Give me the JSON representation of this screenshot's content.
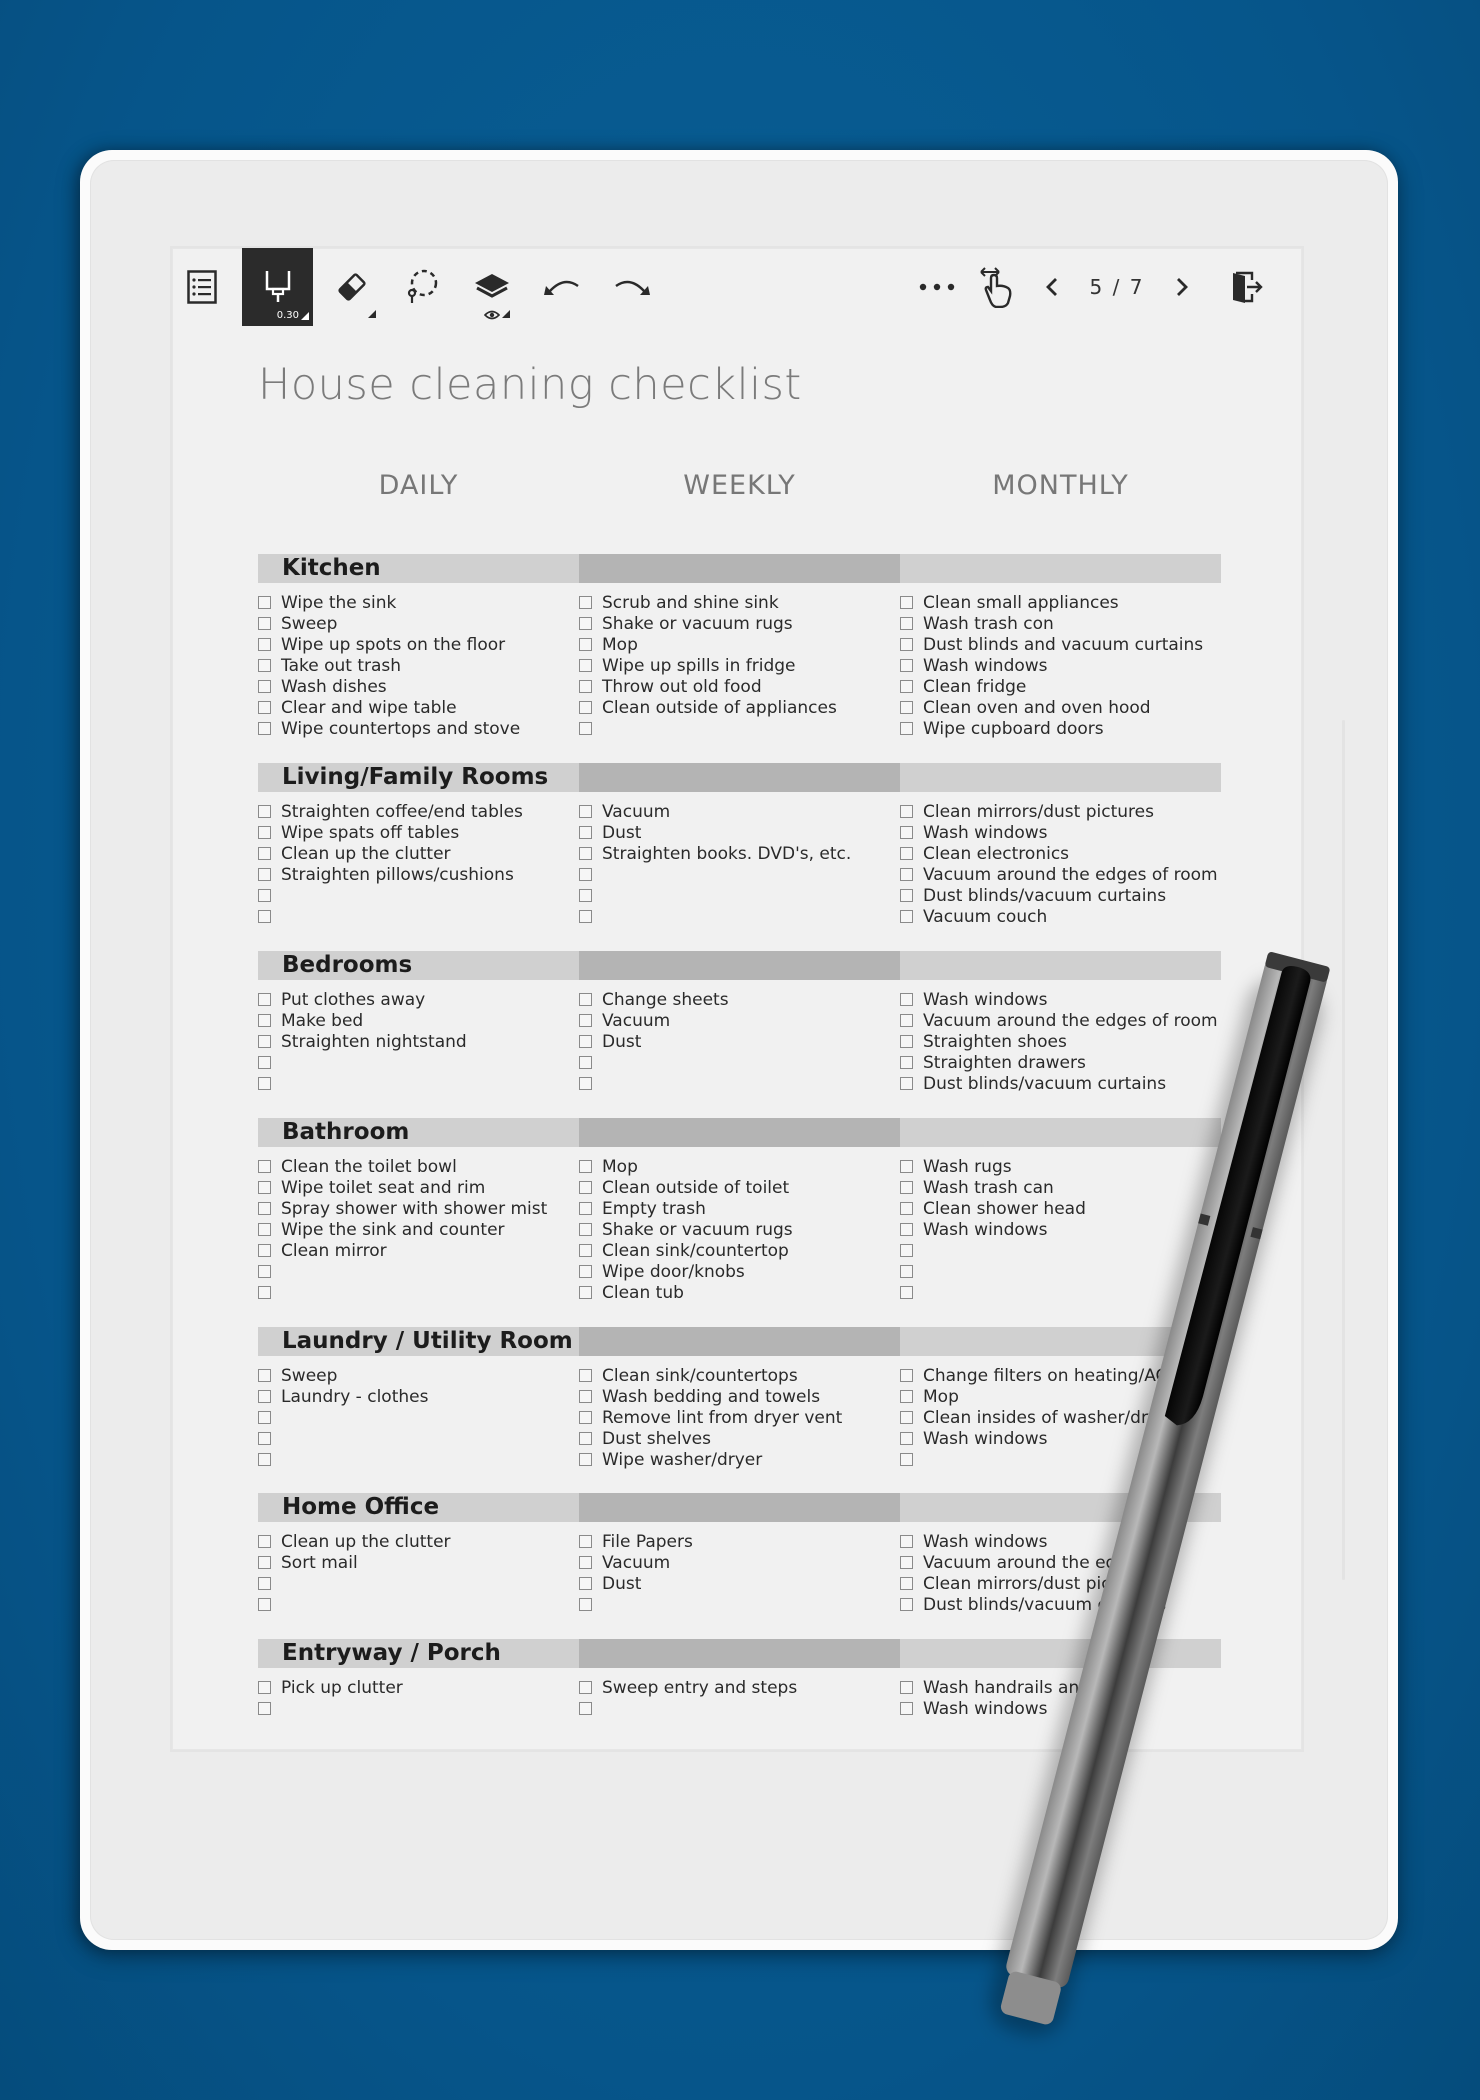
{
  "toolbar": {
    "items": [
      {
        "name": "document-list",
        "icon": "list-icon"
      },
      {
        "name": "pen-tool",
        "icon": "fineliner-pen-icon",
        "active": true,
        "size": "0.30"
      },
      {
        "name": "eraser-tool",
        "icon": "eraser-icon"
      },
      {
        "name": "selection-tool",
        "icon": "lasso-select-icon"
      },
      {
        "name": "layers",
        "icon": "layers-icon",
        "sub_icon": "eye-icon"
      },
      {
        "name": "undo",
        "icon": "undo-icon"
      },
      {
        "name": "redo",
        "icon": "redo-icon"
      }
    ],
    "right": [
      {
        "name": "more",
        "icon": "more-dots-icon"
      },
      {
        "name": "touch",
        "icon": "touch-swipe-icon"
      },
      {
        "name": "prev-page",
        "icon": "chevron-left-icon"
      },
      {
        "name": "next-page",
        "icon": "chevron-right-icon"
      },
      {
        "name": "exit",
        "icon": "exit-door-icon"
      }
    ],
    "pen_size": "0.30",
    "page_indicator": "5 / 7"
  },
  "document": {
    "title": "House cleaning checklist",
    "columns": [
      "DAILY",
      "WEEKLY",
      "MONTHLY"
    ],
    "sections": [
      {
        "name": "Kitchen",
        "daily": [
          "Wipe the sink",
          "Sweep",
          "Wipe up spots on the floor",
          "Take out trash",
          "Wash dishes",
          "Clear and wipe table",
          "Wipe countertops and stove"
        ],
        "weekly": [
          "Scrub and shine sink",
          "Shake or vacuum rugs",
          "Mop",
          "Wipe up spills in fridge",
          "Throw out old food",
          "Clean outside of appliances",
          ""
        ],
        "monthly": [
          "Clean small appliances",
          "Wash trash con",
          "Dust blinds and vacuum curtains",
          "Wash windows",
          "Clean fridge",
          "Clean oven and oven hood",
          "Wipe cupboard doors"
        ]
      },
      {
        "name": "Living/Family Rooms",
        "daily": [
          "Straighten coffee/end tables",
          "Wipe spats off tables",
          "Clean up the clutter",
          "Straighten pillows/cushions",
          "",
          ""
        ],
        "weekly": [
          "Vacuum",
          "Dust",
          "Straighten books. DVD's, etc.",
          "",
          "",
          ""
        ],
        "monthly": [
          "Clean mirrors/dust pictures",
          "Wash windows",
          "Clean electronics",
          "Vacuum around the edges of room",
          "Dust blinds/vacuum curtains",
          "Vacuum couch"
        ]
      },
      {
        "name": "Bedrooms",
        "daily": [
          "Put clothes away",
          "Make bed",
          "Straighten nightstand",
          "",
          ""
        ],
        "weekly": [
          "Change sheets",
          "Vacuum",
          "Dust",
          "",
          ""
        ],
        "monthly": [
          "Wash windows",
          "Vacuum around the edges of room",
          "Straighten shoes",
          "Straighten drawers",
          "Dust blinds/vacuum curtains"
        ]
      },
      {
        "name": "Bathroom",
        "daily": [
          "Clean the toilet bowl",
          "Wipe toilet seat and rim",
          "Spray shower with shower mist",
          "Wipe the sink and counter",
          "Clean mirror",
          "",
          ""
        ],
        "weekly": [
          "Mop",
          "Clean outside of toilet",
          "Empty trash",
          "Shake or vacuum rugs",
          "Clean sink/countertop",
          "Wipe door/knobs",
          "Clean tub"
        ],
        "monthly": [
          "Wash rugs",
          "Wash trash can",
          "Clean shower head",
          "Wash windows",
          "",
          "",
          ""
        ]
      },
      {
        "name": "Laundry / Utility Room",
        "daily": [
          "Sweep",
          "Laundry - clothes",
          "",
          "",
          ""
        ],
        "weekly": [
          "Clean sink/countertops",
          "Wash bedding and towels",
          "Remove lint from dryer vent",
          "Dust shelves",
          "Wipe washer/dryer"
        ],
        "monthly": [
          "Change filters on heating/AC un",
          "Mop",
          "Clean insides of washer/dryer",
          "Wash windows",
          ""
        ]
      },
      {
        "name": "Home Office",
        "daily": [
          "Clean up the clutter",
          "Sort mail",
          "",
          ""
        ],
        "weekly": [
          "File Papers",
          "Vacuum",
          "Dust",
          ""
        ],
        "monthly": [
          "Wash windows",
          "Vacuum around the edges",
          "Clean mirrors/dust pictures",
          "Dust blinds/vacuum curtains"
        ]
      },
      {
        "name": "Entryway / Porch",
        "daily": [
          "Pick up clutter",
          ""
        ],
        "weekly": [
          "Sweep entry and steps",
          ""
        ],
        "monthly": [
          "Wash handrails and doors",
          "Wash windows"
        ]
      }
    ]
  },
  "colors": {
    "background": "#075a8f",
    "screen": "#f1f1f1",
    "bar_light": "#d0d0d0",
    "bar_dark": "#b4b4b4",
    "active_tool": "#2b2b2b"
  }
}
